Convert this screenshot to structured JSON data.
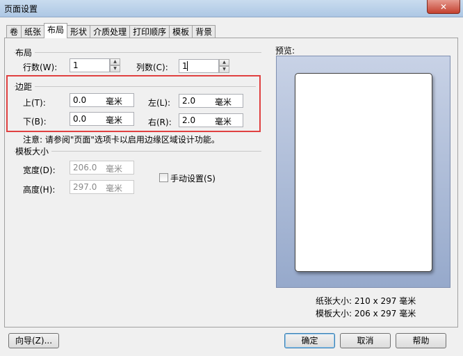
{
  "window": {
    "title": "页面设置",
    "close": "✕"
  },
  "tabs": [
    "卷",
    "纸张",
    "布局",
    "形状",
    "介质处理",
    "打印顺序",
    "模板",
    "背景"
  ],
  "layout_group": {
    "title": "布局",
    "rows_label": "行数(W):",
    "rows_value": "1",
    "cols_label": "列数(C):",
    "cols_value": "1"
  },
  "margins_group": {
    "title": "边距",
    "top_label": "上(T):",
    "top_value": "0.0",
    "bottom_label": "下(B):",
    "bottom_value": "0.0",
    "left_label": "左(L):",
    "left_value": "2.0",
    "right_label": "右(R):",
    "right_value": "2.0",
    "unit": "毫米"
  },
  "note": "注意: 请参阅\"页面\"选项卡以启用边缘区域设计功能。",
  "template_group": {
    "title": "模板大小",
    "width_label": "宽度(D):",
    "width_value": "206.0",
    "height_label": "高度(H):",
    "height_value": "297.0",
    "unit": "毫米",
    "manual_label": "手动设置(S)"
  },
  "preview": {
    "label": "预览:",
    "paper_size": "纸张大小: 210 x 297 毫米",
    "template_size": "模板大小: 206 x 297 毫米"
  },
  "buttons": {
    "wizard": "向导(Z)...",
    "ok": "确定",
    "cancel": "取消",
    "help": "帮助"
  }
}
